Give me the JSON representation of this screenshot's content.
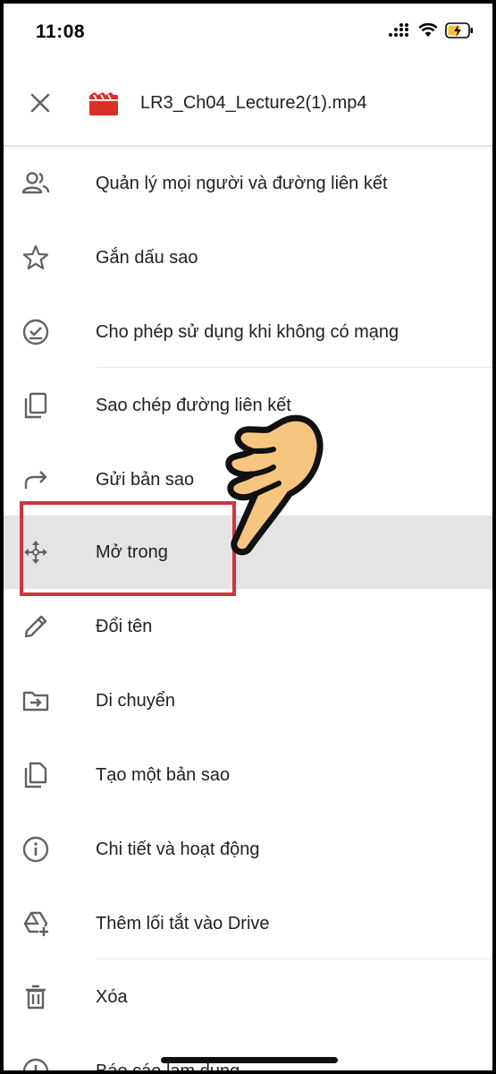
{
  "status_bar": {
    "time": "11:08"
  },
  "header": {
    "file_name": "LR3_Ch04_Lecture2(1).mp4",
    "file_icon_color": "#d93025"
  },
  "menu": {
    "items": [
      {
        "label": "Quản lý mọi người và đường liên kết",
        "icon": "people-icon"
      },
      {
        "label": "Gắn dấu sao",
        "icon": "star-icon"
      },
      {
        "label": "Cho phép sử dụng khi không có mạng",
        "icon": "offline-check-icon"
      },
      {
        "label": "Sao chép đường liên kết",
        "icon": "copy-link-icon"
      },
      {
        "label": "Gửi bản sao",
        "icon": "share-arrow-icon"
      },
      {
        "label": "Mở trong",
        "icon": "move-arrows-icon"
      },
      {
        "label": "Đổi tên",
        "icon": "pencil-icon"
      },
      {
        "label": "Di chuyển",
        "icon": "move-folder-icon"
      },
      {
        "label": "Tạo một bản sao",
        "icon": "duplicate-icon"
      },
      {
        "label": "Chi tiết và hoạt động",
        "icon": "info-icon"
      },
      {
        "label": "Thêm lối tắt vào Drive",
        "icon": "drive-shortcut-icon"
      },
      {
        "label": "Xóa",
        "icon": "trash-icon"
      },
      {
        "label": "Báo cáo lạm dụng",
        "icon": "report-icon"
      }
    ]
  },
  "colors": {
    "highlight_border": "#d0343f",
    "active_row": "#e4e4e4",
    "hand_fill": "#f6c57f"
  }
}
